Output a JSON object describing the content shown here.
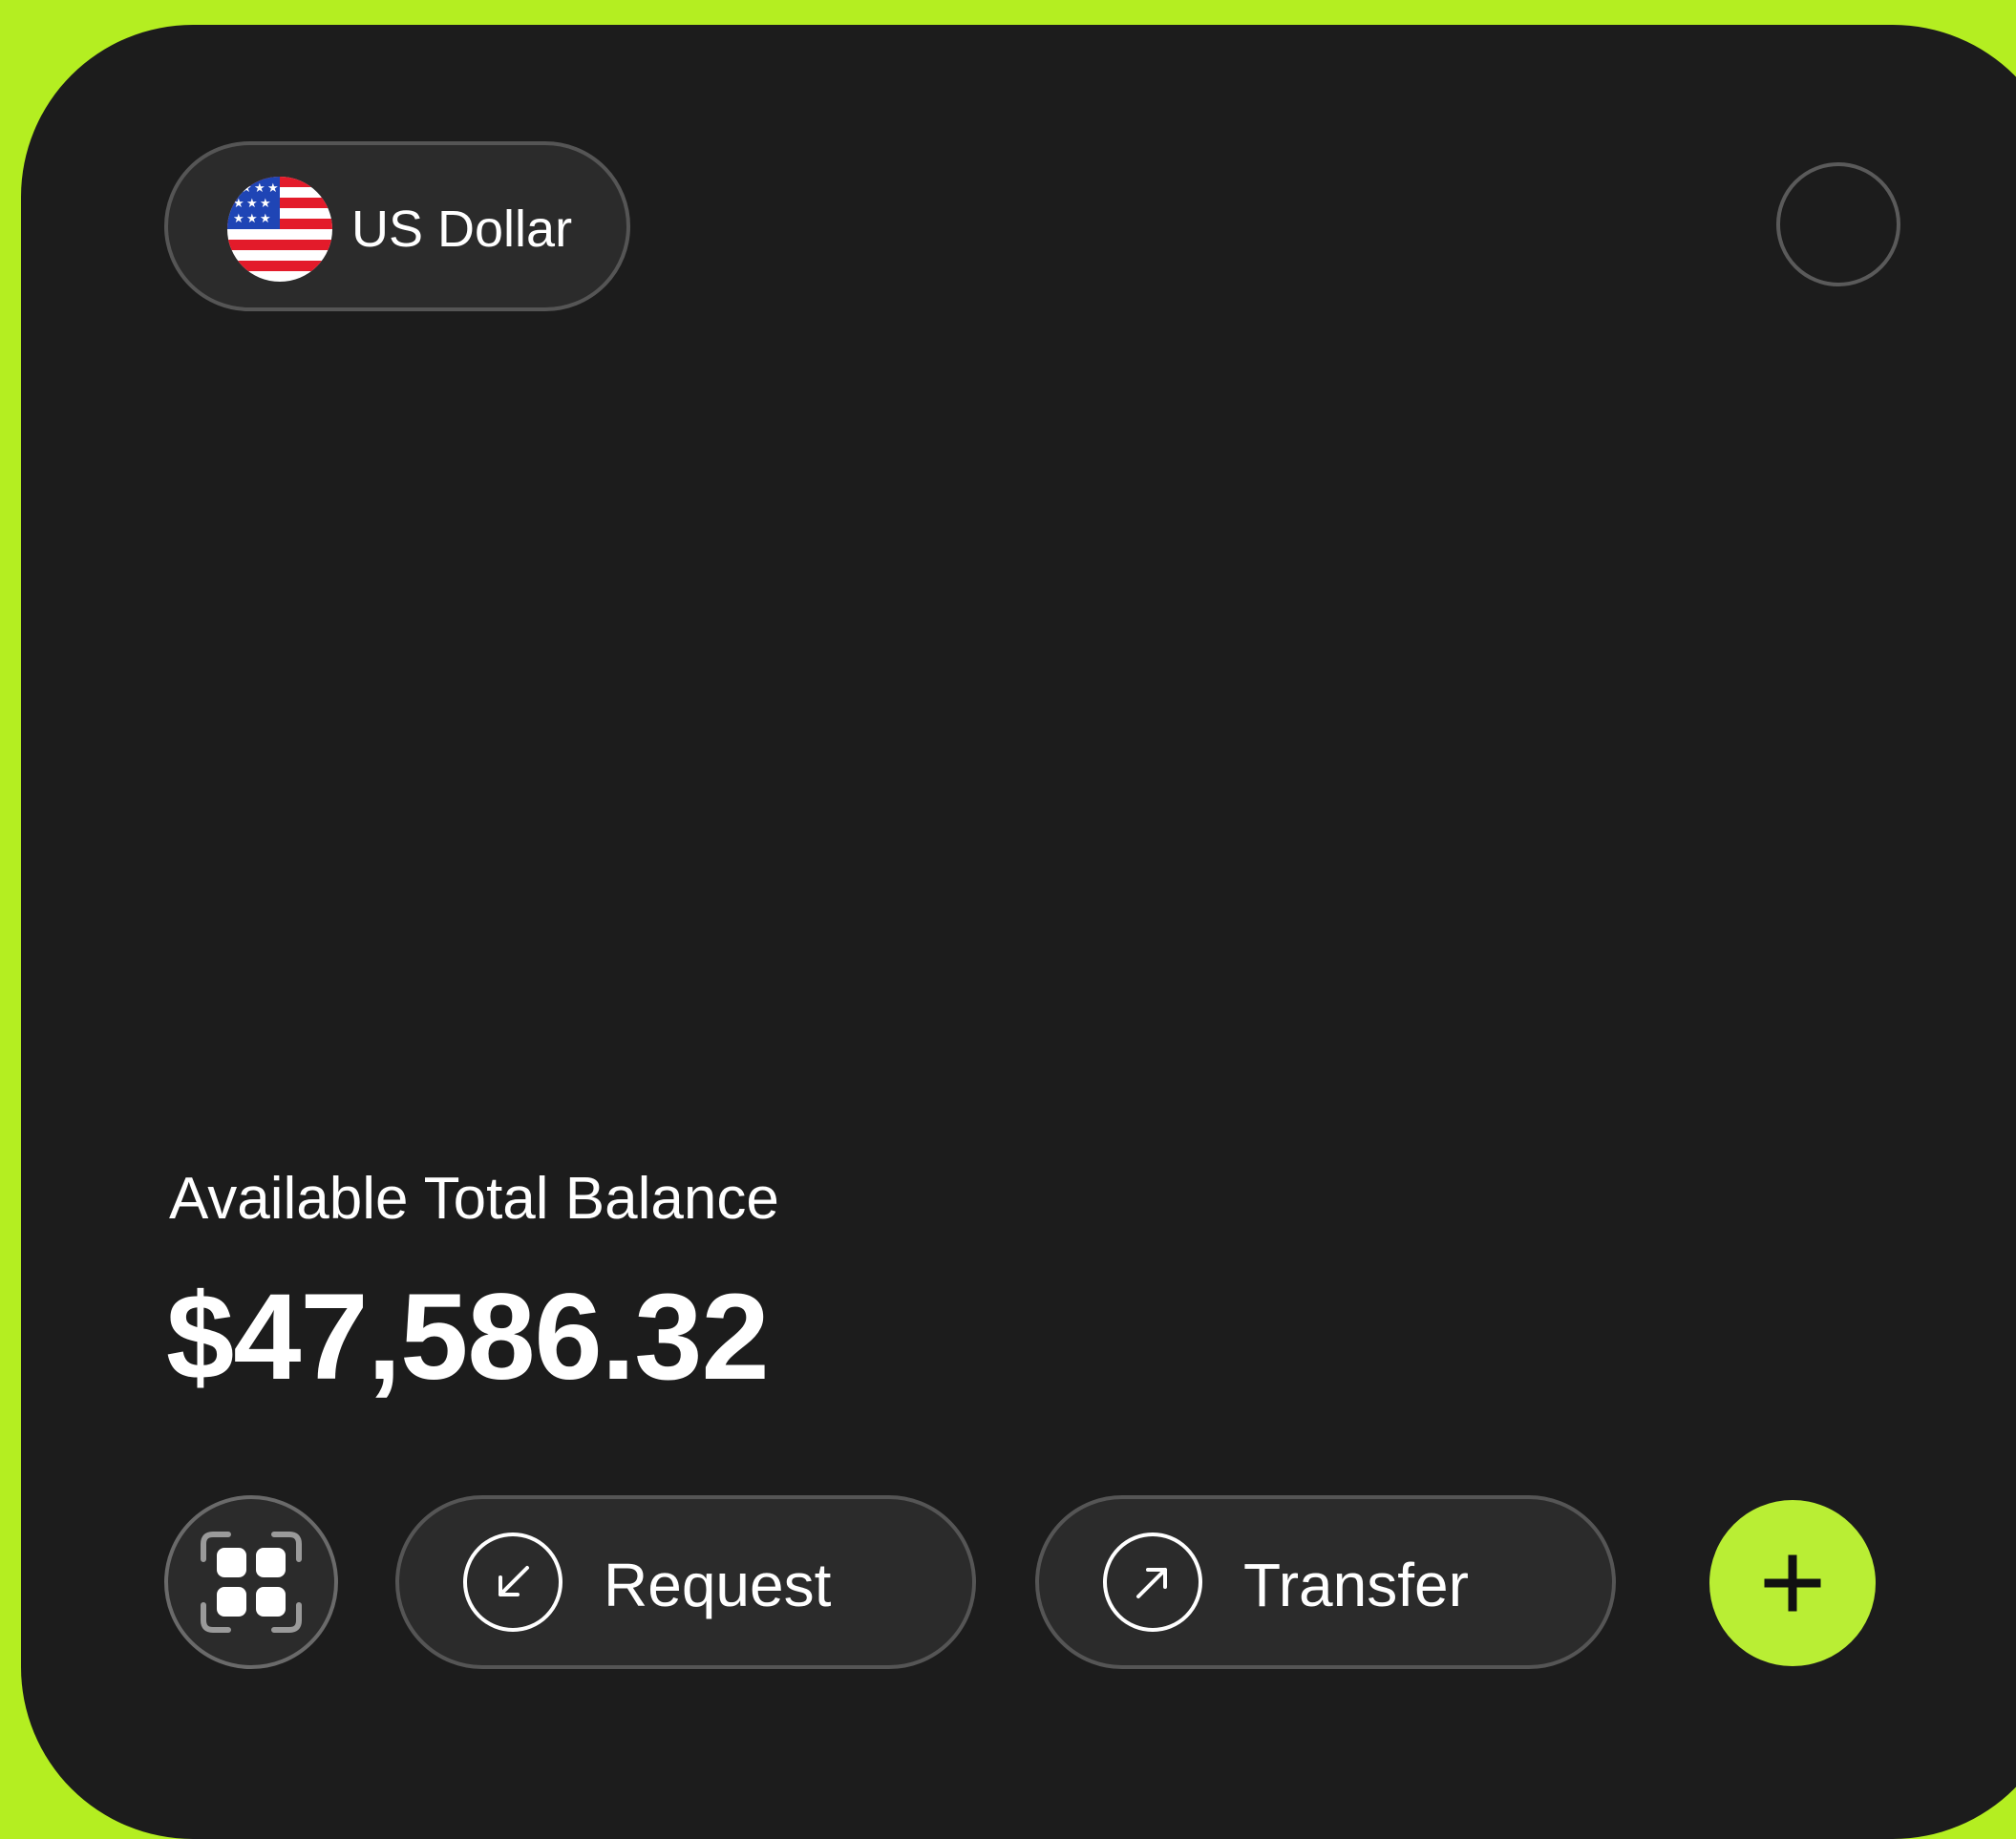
{
  "currency": {
    "label": "US Dollar",
    "flag_icon": "us-flag-icon"
  },
  "balance": {
    "label": "Available Total Balance",
    "amount": "$47,586.32"
  },
  "actions": {
    "grid_icon": "grid-icon",
    "request_label": "Request",
    "request_icon": "arrow-down-left-icon",
    "transfer_label": "Transfer",
    "transfer_icon": "arrow-up-right-icon",
    "add_icon": "plus-icon"
  },
  "colors": {
    "background": "#b4ee21",
    "card": "#1c1c1c",
    "pill": "#2b2b2b",
    "accent": "#b9ee34",
    "text": "#ffffff"
  }
}
